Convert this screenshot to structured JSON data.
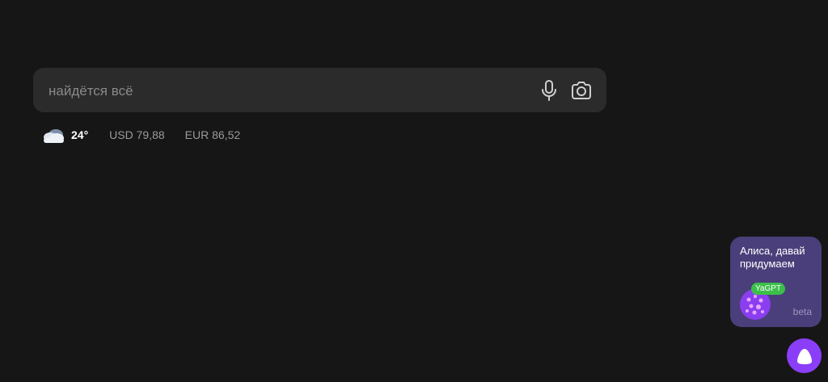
{
  "search": {
    "placeholder": "найдётся всё",
    "voice_icon": "microphone-icon",
    "camera_icon": "camera-icon"
  },
  "informer": {
    "weather_icon": "cloud-icon",
    "temperature": "24°",
    "usd": "USD 79,88",
    "eur": "EUR 86,52"
  },
  "promo": {
    "text": "Алиса, давай придумаем",
    "badge": "YaGPT",
    "beta": "beta"
  },
  "alice_button": {
    "icon": "alice-icon"
  },
  "colors": {
    "background": "#161616",
    "search_bg": "#2b2b2b",
    "promo_bg": "#4a3f7a",
    "badge_green": "#3bbf4a",
    "alice_purple": "#8b3ef7"
  }
}
